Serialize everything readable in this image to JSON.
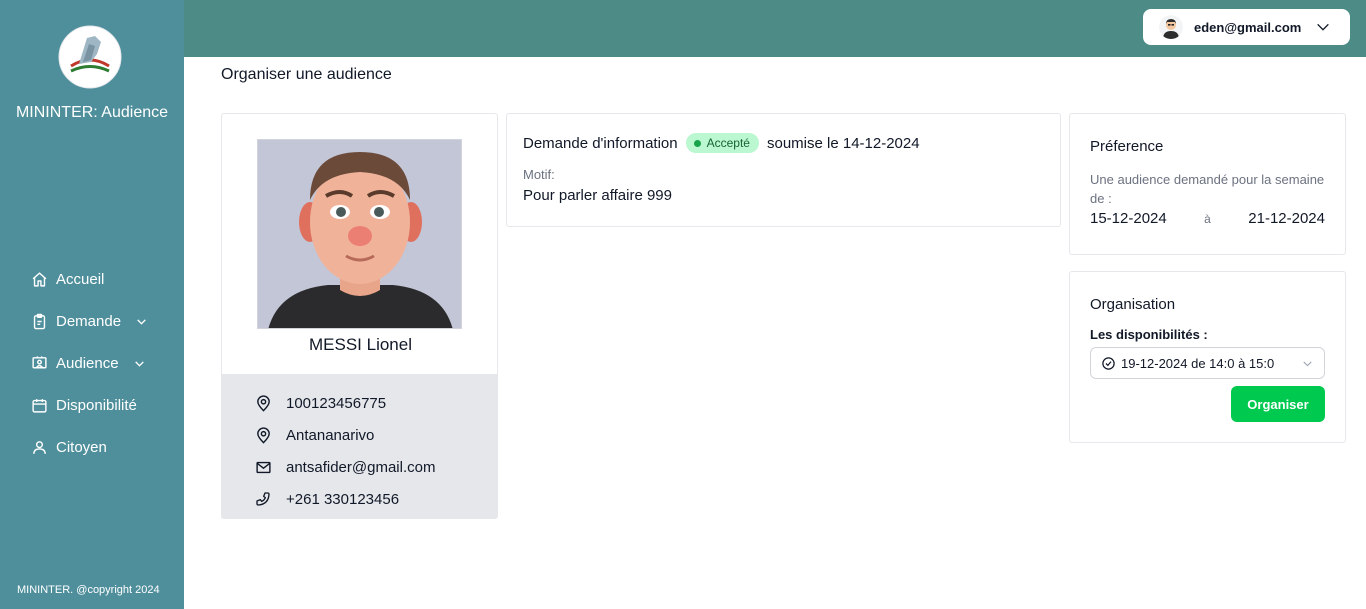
{
  "app": {
    "title": "MININTER: Audience",
    "footer": "MININTER. @copyright 2024"
  },
  "sidebar": {
    "items": [
      {
        "label": "Accueil",
        "icon": "home-icon"
      },
      {
        "label": "Demande",
        "icon": "clipboard-icon",
        "has_submenu": true
      },
      {
        "label": "Audience",
        "icon": "presentation-icon",
        "has_submenu": true
      },
      {
        "label": "Disponibilité",
        "icon": "calendar-icon"
      },
      {
        "label": "Citoyen",
        "icon": "user-icon"
      }
    ]
  },
  "header": {
    "user_email": "eden@gmail.com"
  },
  "page": {
    "title": "Organiser une audience"
  },
  "profile": {
    "name": "MESSI Lionel",
    "id_number": "100123456775",
    "city": "Antananarivo",
    "email": "antsafider@gmail.com",
    "phone": "+261 330123456"
  },
  "demand": {
    "title": "Demande d'information",
    "status": "Accepté",
    "submitted": "soumise le 14-12-2024",
    "motif_label": "Motif:",
    "motif_value": "Pour parler affaire 999"
  },
  "preference": {
    "title": "Préference",
    "description": "Une audience demandé pour la semaine de :",
    "date_from": "15-12-2024",
    "separator": "à",
    "date_to": "21-12-2024"
  },
  "organisation": {
    "title": "Organisation",
    "availability_label": "Les disponibilités :",
    "selected_slot": "19-12-2024 de 14:0 à 15:0",
    "button_label": "Organiser"
  },
  "colors": {
    "sidebar_bg": "#4f8f9c",
    "topbar_bg": "#4d8b86",
    "accent_green": "#00c950",
    "badge_bg": "#bbf7d0"
  }
}
